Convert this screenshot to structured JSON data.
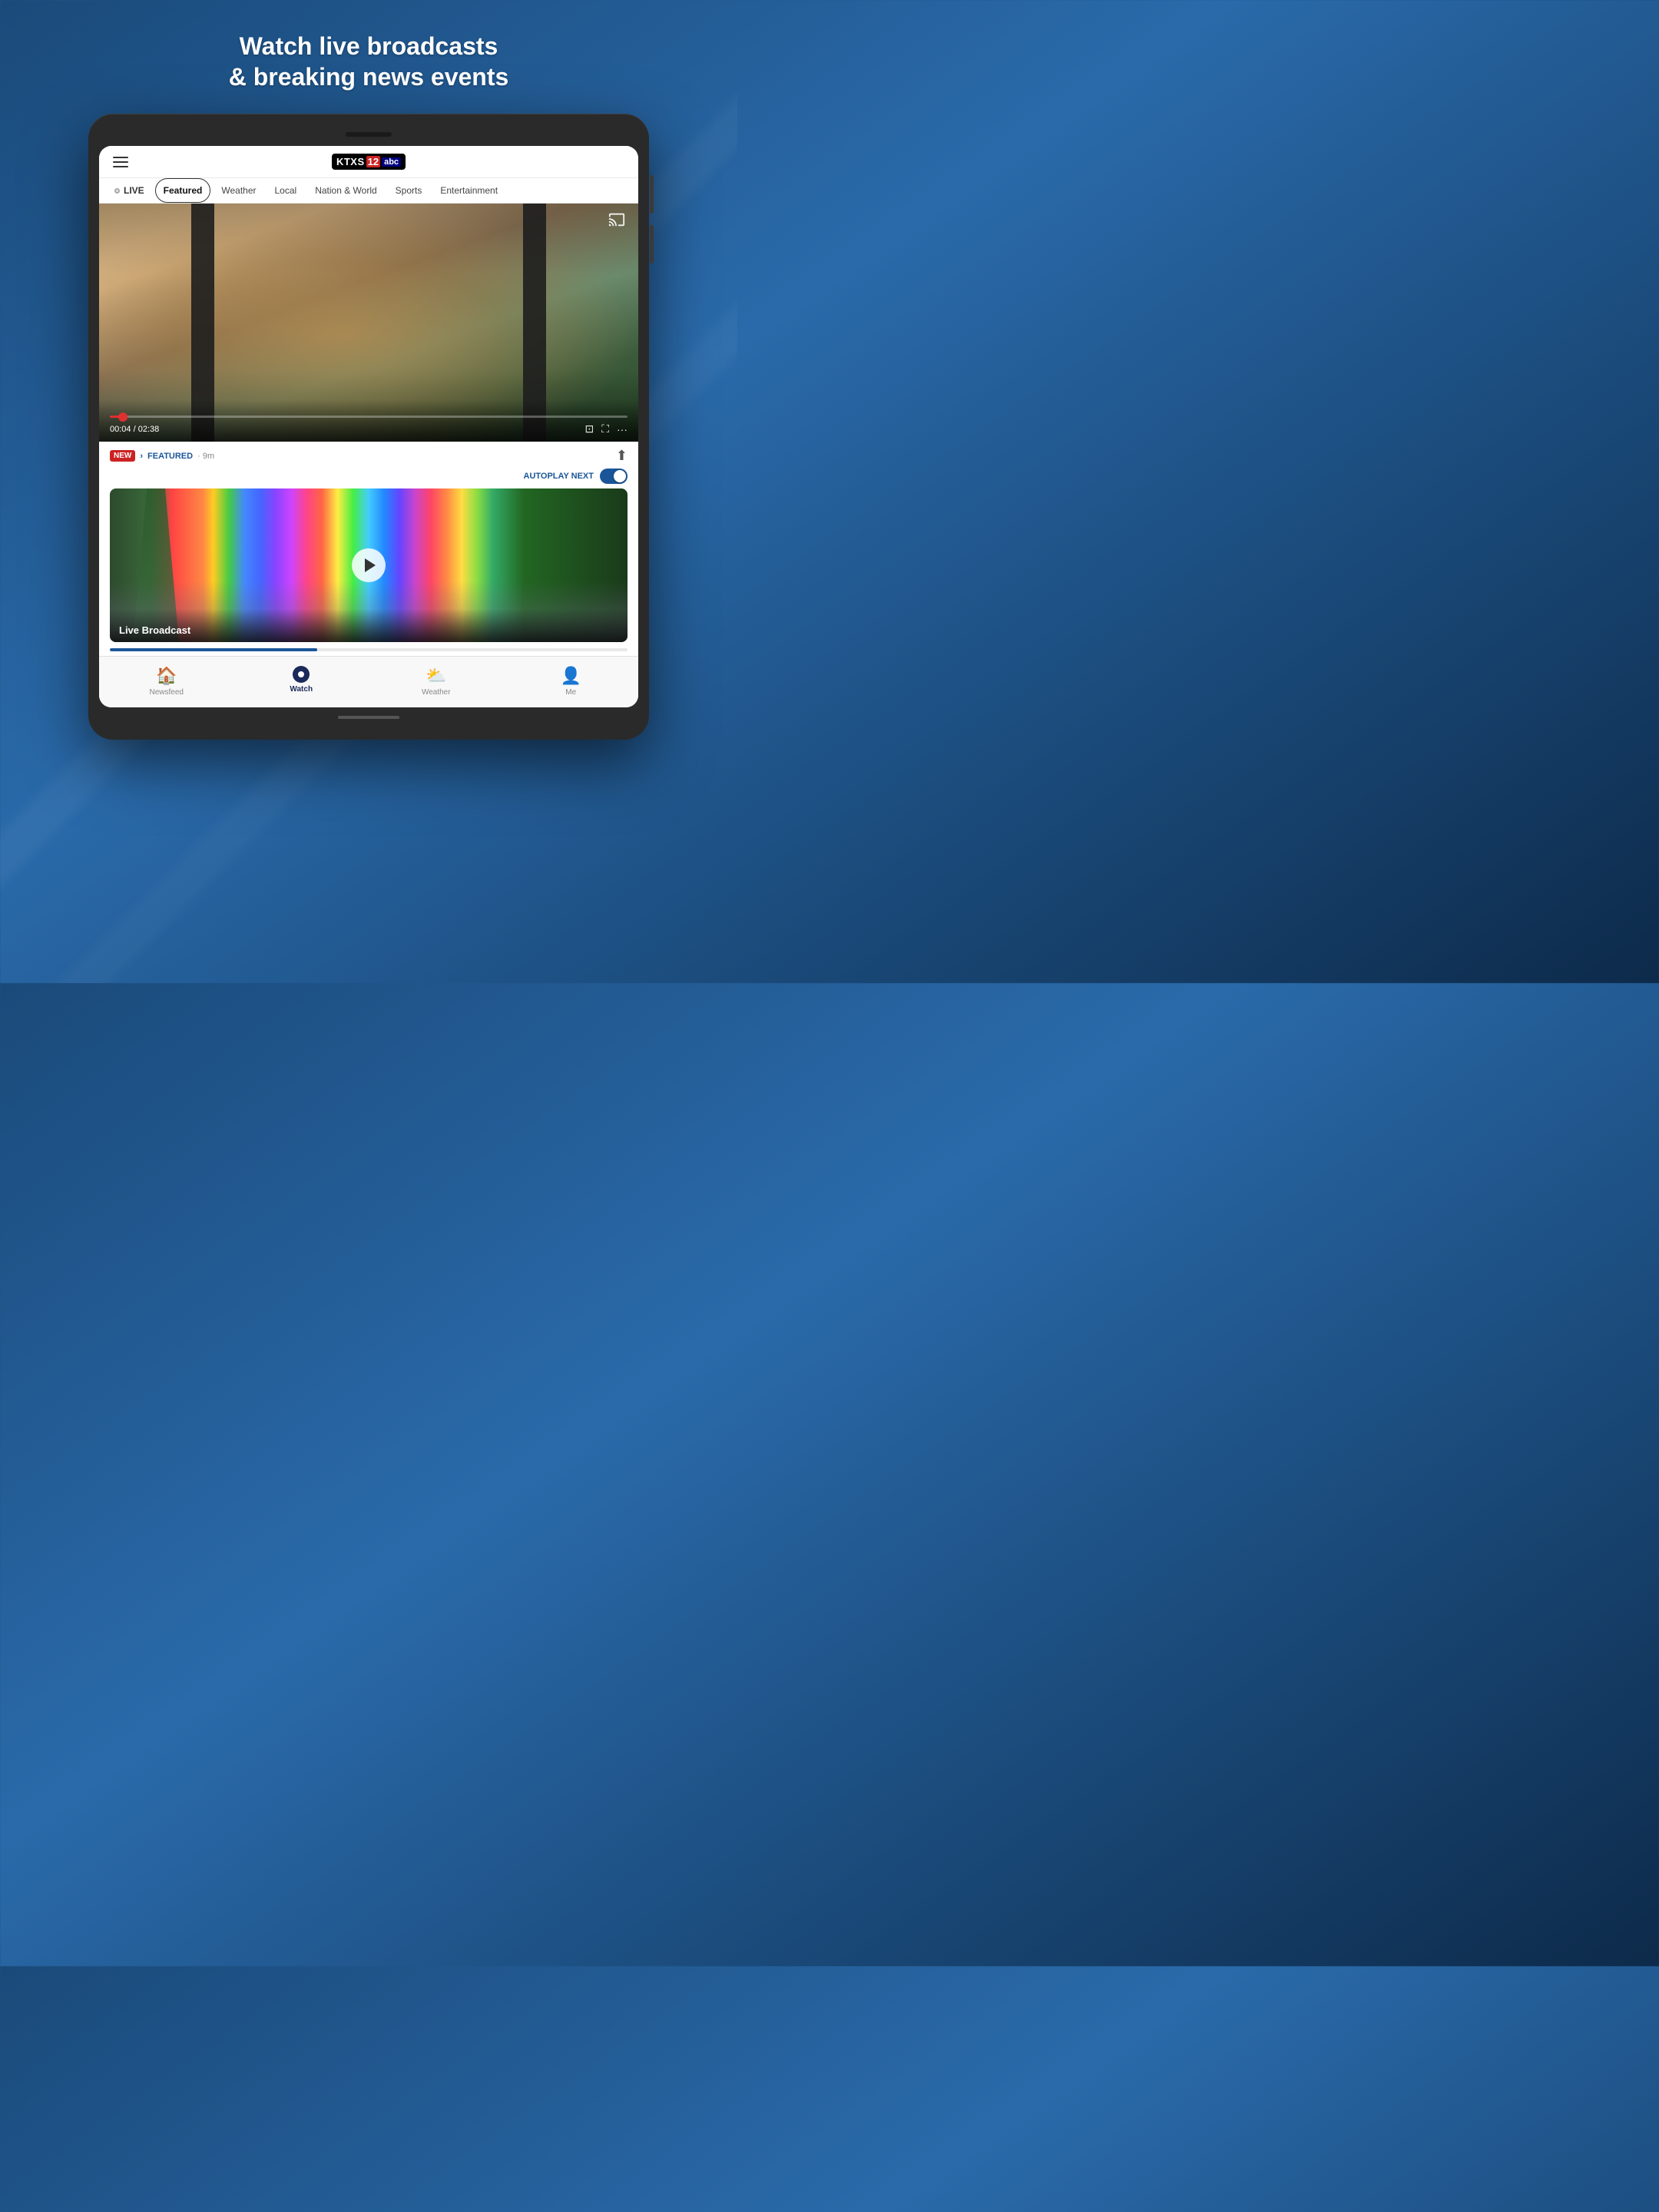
{
  "page": {
    "headline_line1": "Watch live broadcasts",
    "headline_line2": "& breaking news events"
  },
  "header": {
    "menu_label": "Menu",
    "logo_ktxs": "KTXS",
    "logo_12": "12",
    "logo_abc": "abc"
  },
  "nav": {
    "tabs": [
      {
        "id": "live",
        "label": "LIVE",
        "active": false
      },
      {
        "id": "featured",
        "label": "Featured",
        "active": true
      },
      {
        "id": "weather",
        "label": "Weather",
        "active": false
      },
      {
        "id": "local",
        "label": "Local",
        "active": false
      },
      {
        "id": "nation-world",
        "label": "Nation & World",
        "active": false
      },
      {
        "id": "sports",
        "label": "Sports",
        "active": false
      },
      {
        "id": "entertainment",
        "label": "Entertainment",
        "active": false
      }
    ]
  },
  "video": {
    "current_time": "00:04",
    "total_time": "02:38",
    "progress_percent": 2.5
  },
  "content": {
    "badge_new": "NEW",
    "badge_featured": "FEATURED",
    "time_ago": "9m",
    "autoplay_label": "AUTOPLAY NEXT",
    "card_title": "Live Broadcast"
  },
  "bottom_nav": {
    "items": [
      {
        "id": "newsfeed",
        "label": "Newsfeed",
        "icon": "🏠",
        "active": false
      },
      {
        "id": "watch",
        "label": "Watch",
        "icon": "▶",
        "active": true
      },
      {
        "id": "weather",
        "label": "Weather",
        "icon": "⛅",
        "active": false
      },
      {
        "id": "me",
        "label": "Me",
        "icon": "👤",
        "active": false
      }
    ]
  }
}
